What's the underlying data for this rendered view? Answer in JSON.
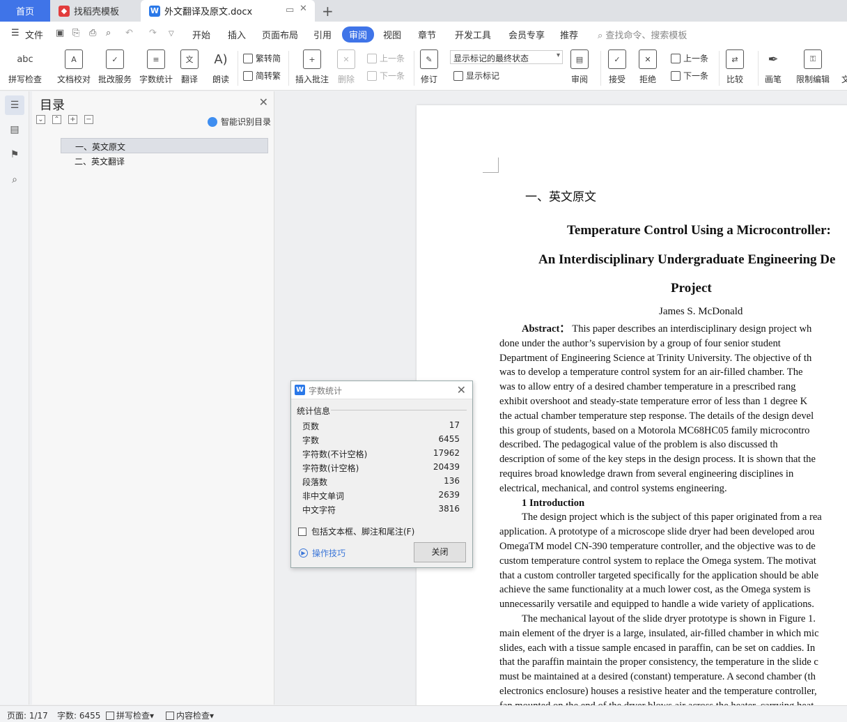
{
  "tabs": {
    "home": "首页",
    "template": "找稻壳模板",
    "document": "外文翻译及原文.docx"
  },
  "menu": {
    "file": "文件",
    "items": [
      "开始",
      "插入",
      "页面布局",
      "引用",
      "审阅",
      "视图",
      "章节",
      "开发工具",
      "会员专享",
      "推荐"
    ],
    "active": "审阅",
    "search_placeholder": "查找命令、搜索模板"
  },
  "ribbon": {
    "spell_check": "拼写检查",
    "proofread": "文档校对",
    "review_service": "批改服务",
    "word_count": "字数统计",
    "translate": "翻译",
    "read_aloud": "朗读",
    "trad_to_simp": "繁转简",
    "simp_to_trad": "简转繁",
    "insert_comment": "插入批注",
    "delete": "删除",
    "prev_comment": "上一条",
    "next_comment": "下一条",
    "revise": "修订",
    "markup_state": "显示标记的最终状态",
    "show_markup": "显示标记",
    "review": "审阅",
    "accept": "接受",
    "reject": "拒绝",
    "prev_change": "上一条",
    "next_change": "下一条",
    "compare": "比较",
    "pen": "画笔",
    "restrict_edit": "限制编辑",
    "doc_cut": "文"
  },
  "nav": {
    "title": "目录",
    "smart_toc": "智能识别目录",
    "items": [
      "一、英文原文",
      "二、英文翻译"
    ]
  },
  "doc": {
    "heading": "一、英文原文",
    "title1": "Temperature Control Using a Microcontroller:",
    "title2": "An Interdisciplinary Undergraduate Engineering De",
    "title3": "Project",
    "author": "James S. McDonald",
    "lines": [
      {
        "b": "Abstract：",
        "t": " This paper describes an interdisciplinary design project wh",
        "ind": true
      },
      {
        "t": "done under the author’s supervision by a group of four senior student"
      },
      {
        "t": "Department of Engineering Science at Trinity University. The objective of th"
      },
      {
        "t": "was to develop a temperature control system for an air-filled chamber. The"
      },
      {
        "t": "was to allow entry of a desired chamber temperature in a prescribed rang"
      },
      {
        "t": "exhibit overshoot and steady-state temperature error of less than 1 degree K"
      },
      {
        "t": "the actual chamber temperature step response. The details of the design devel"
      },
      {
        "t": "this group of students, based on a Motorola MC68HC05 family microcontro"
      },
      {
        "t": "described. The pedagogical value of the problem is also discussed th"
      },
      {
        "t": "description of some of the key steps in the design process. It is shown that the"
      },
      {
        "t": "requires broad knowledge drawn from several engineering disciplines in"
      },
      {
        "t": "electrical, mechanical, and control systems engineering."
      },
      {
        "b": "1 Introduction",
        "t": "",
        "ind": true
      },
      {
        "t": "The design project which is the subject of this paper originated from a rea",
        "ind": true
      },
      {
        "t": "application. A prototype of a microscope slide dryer had been developed arou"
      },
      {
        "t": "OmegaTM model CN-390 temperature controller, and the objective was to de"
      },
      {
        "t": "custom temperature control system to replace the Omega system. The motivat"
      },
      {
        "t": "that a custom controller targeted specifically for the application should be able"
      },
      {
        "t": "achieve the same functionality at a much lower cost, as the Omega system is"
      },
      {
        "t": "unnecessarily versatile and equipped to handle a wide variety of applications."
      },
      {
        "t": "The mechanical layout of the slide dryer prototype is shown in Figure 1.",
        "ind": true
      },
      {
        "t": "main element of the dryer is a large, insulated, air-filled chamber in which mic"
      },
      {
        "t": "slides, each with a tissue sample encased in paraffin, can be set on caddies. In"
      },
      {
        "t": "that the paraffin maintain the proper consistency, the temperature in the slide c"
      },
      {
        "t": "must be maintained at a desired (constant) temperature. A second chamber (th"
      },
      {
        "t": "electronics enclosure) houses a resistive heater and the temperature controller,"
      },
      {
        "t": "fan mounted on the end of the dryer blows air across the heater, carrying heat"
      }
    ]
  },
  "dialog": {
    "title": "字数统计",
    "group": "统计信息",
    "stats": [
      {
        "label": "页数",
        "value": "17"
      },
      {
        "label": "字数",
        "value": "6455"
      },
      {
        "label": "字符数(不计空格)",
        "value": "17962"
      },
      {
        "label": "字符数(计空格)",
        "value": "20439"
      },
      {
        "label": "段落数",
        "value": "136"
      },
      {
        "label": "非中文单词",
        "value": "2639"
      },
      {
        "label": "中文字符",
        "value": "3816"
      }
    ],
    "include_textbox": "包括文本框、脚注和尾注(F)",
    "tips": "操作技巧",
    "close": "关闭"
  },
  "status": {
    "page": "页面: 1/17",
    "words": "字数: 6455",
    "spell": "拼写检查",
    "content": "内容检查"
  },
  "colors": {
    "accent": "#3f74e8"
  }
}
